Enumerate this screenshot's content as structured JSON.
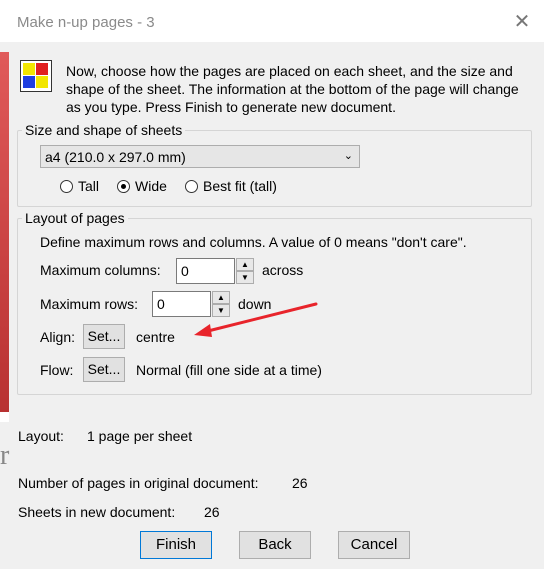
{
  "window": {
    "title": "Make n-up pages - 3"
  },
  "intro": {
    "text": "Now, choose how the pages are placed on each sheet, and the size and shape of the sheet. The information at the bottom of the page will change as you type. Press Finish to generate new document."
  },
  "sheets": {
    "legend": "Size and shape of sheets",
    "size_value": "a4 (210.0 x 297.0 mm)",
    "orientation": [
      {
        "label": "Tall",
        "selected": false
      },
      {
        "label": "Wide",
        "selected": true
      },
      {
        "label": "Best fit (tall)",
        "selected": false
      }
    ]
  },
  "layout_group": {
    "legend": "Layout of pages",
    "hint": "Define maximum rows and columns. A value of 0 means \"don't care\".",
    "max_columns_label": "Maximum columns:",
    "max_columns_value": "0",
    "max_columns_unit": "across",
    "max_rows_label": "Maximum rows:",
    "max_rows_value": "0",
    "max_rows_unit": "down",
    "align_label": "Align:",
    "align_button": "Set...",
    "align_value": "centre",
    "flow_label": "Flow:",
    "flow_button": "Set...",
    "flow_value": "Normal (fill one side at a time)"
  },
  "summary": {
    "layout_label": "Layout:",
    "layout_value": "1 page per sheet",
    "pages_label": "Number of pages in original document:",
    "pages_value": "26",
    "sheets_label": "Sheets in new document:",
    "sheets_value": "26"
  },
  "buttons": {
    "finish": "Finish",
    "back": "Back",
    "cancel": "Cancel"
  },
  "colors": {
    "annotation_arrow": "#e8242b",
    "accent": "#0078d7"
  },
  "icons": [
    "app-nup-icon",
    "close-icon",
    "chevron-down-icon",
    "spin-up-icon",
    "spin-down-icon",
    "red-arrow-annotation-icon"
  ]
}
